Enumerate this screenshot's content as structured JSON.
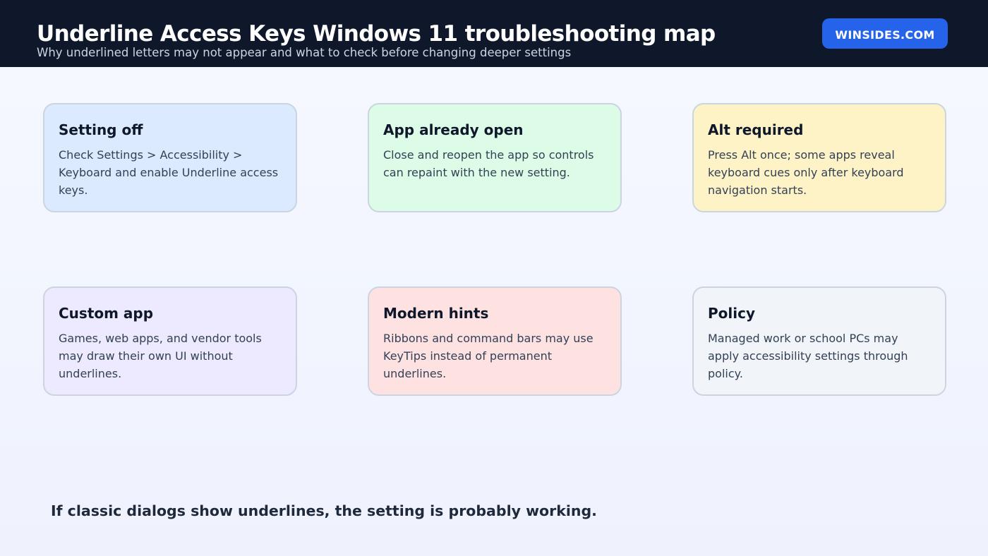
{
  "header": {
    "title": "Underline Access Keys Windows 11 troubleshooting map",
    "subtitle": "Why underlined letters may not appear and what to check before changing deeper settings",
    "brand_label": "WINSIDES.COM"
  },
  "cards": [
    {
      "title": "Setting off",
      "body": "Check Settings > Accessibility > Keyboard and enable Underline access keys.",
      "color": "#dbeafe"
    },
    {
      "title": "App already open",
      "body": "Close and reopen the app so controls can repaint with the new setting.",
      "color": "#dcfce7"
    },
    {
      "title": "Alt required",
      "body": "Press Alt once; some apps reveal keyboard cues only after keyboard navigation starts.",
      "color": "#fef3c7"
    },
    {
      "title": "Custom app",
      "body": "Games, web apps, and vendor tools may draw their own UI without underlines.",
      "color": "#ede9fe"
    },
    {
      "title": "Modern hints",
      "body": "Ribbons and command bars may use KeyTips instead of permanent underlines.",
      "color": "#fee2e2"
    },
    {
      "title": "Policy",
      "body": "Managed work or school PCs may apply accessibility settings through policy.",
      "color": "#f1f5f9"
    }
  ],
  "footer": {
    "note": "If classic dialogs show underlines, the setting is probably working."
  },
  "colors": {
    "header_bg": "#0f172a",
    "brand_bg": "#2563eb",
    "card_border": "#cbd5e1"
  }
}
